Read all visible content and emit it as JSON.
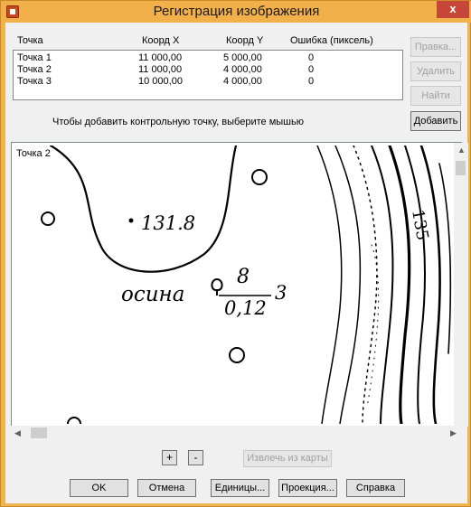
{
  "window": {
    "title": "Регистрация изображения",
    "close_label": "x"
  },
  "points_table": {
    "headers": [
      "Точка",
      "Коорд X",
      "Коорд Y",
      "Ошибка (пиксель)"
    ],
    "rows": [
      [
        "Точка 1",
        "11 000,00",
        "5 000,00",
        "0"
      ],
      [
        "Точка 2",
        "11 000,00",
        "4 000,00",
        "0"
      ],
      [
        "Точка 3",
        "10 000,00",
        "4 000,00",
        "0"
      ]
    ]
  },
  "side_buttons": {
    "edit": "Правка...",
    "delete": "Удалить",
    "find": "Найти",
    "add": "Добавить"
  },
  "hint": "Чтобы добавить контрольную точку, выберите мышью",
  "map": {
    "current_point_label": "Точка 2",
    "elevation_label": "131.8",
    "contour_label": "135",
    "tree_label": "осина",
    "tree_fraction_top": "8",
    "tree_fraction_bottom": "0,12",
    "tree_count": "3"
  },
  "zoom": {
    "in_label": "+",
    "out_label": "-"
  },
  "extract_button": "Извлечь из карты",
  "bottom_buttons": {
    "ok": "OK",
    "cancel": "Отмена",
    "units": "Единицы...",
    "projection": "Проекция...",
    "help": "Справка"
  }
}
